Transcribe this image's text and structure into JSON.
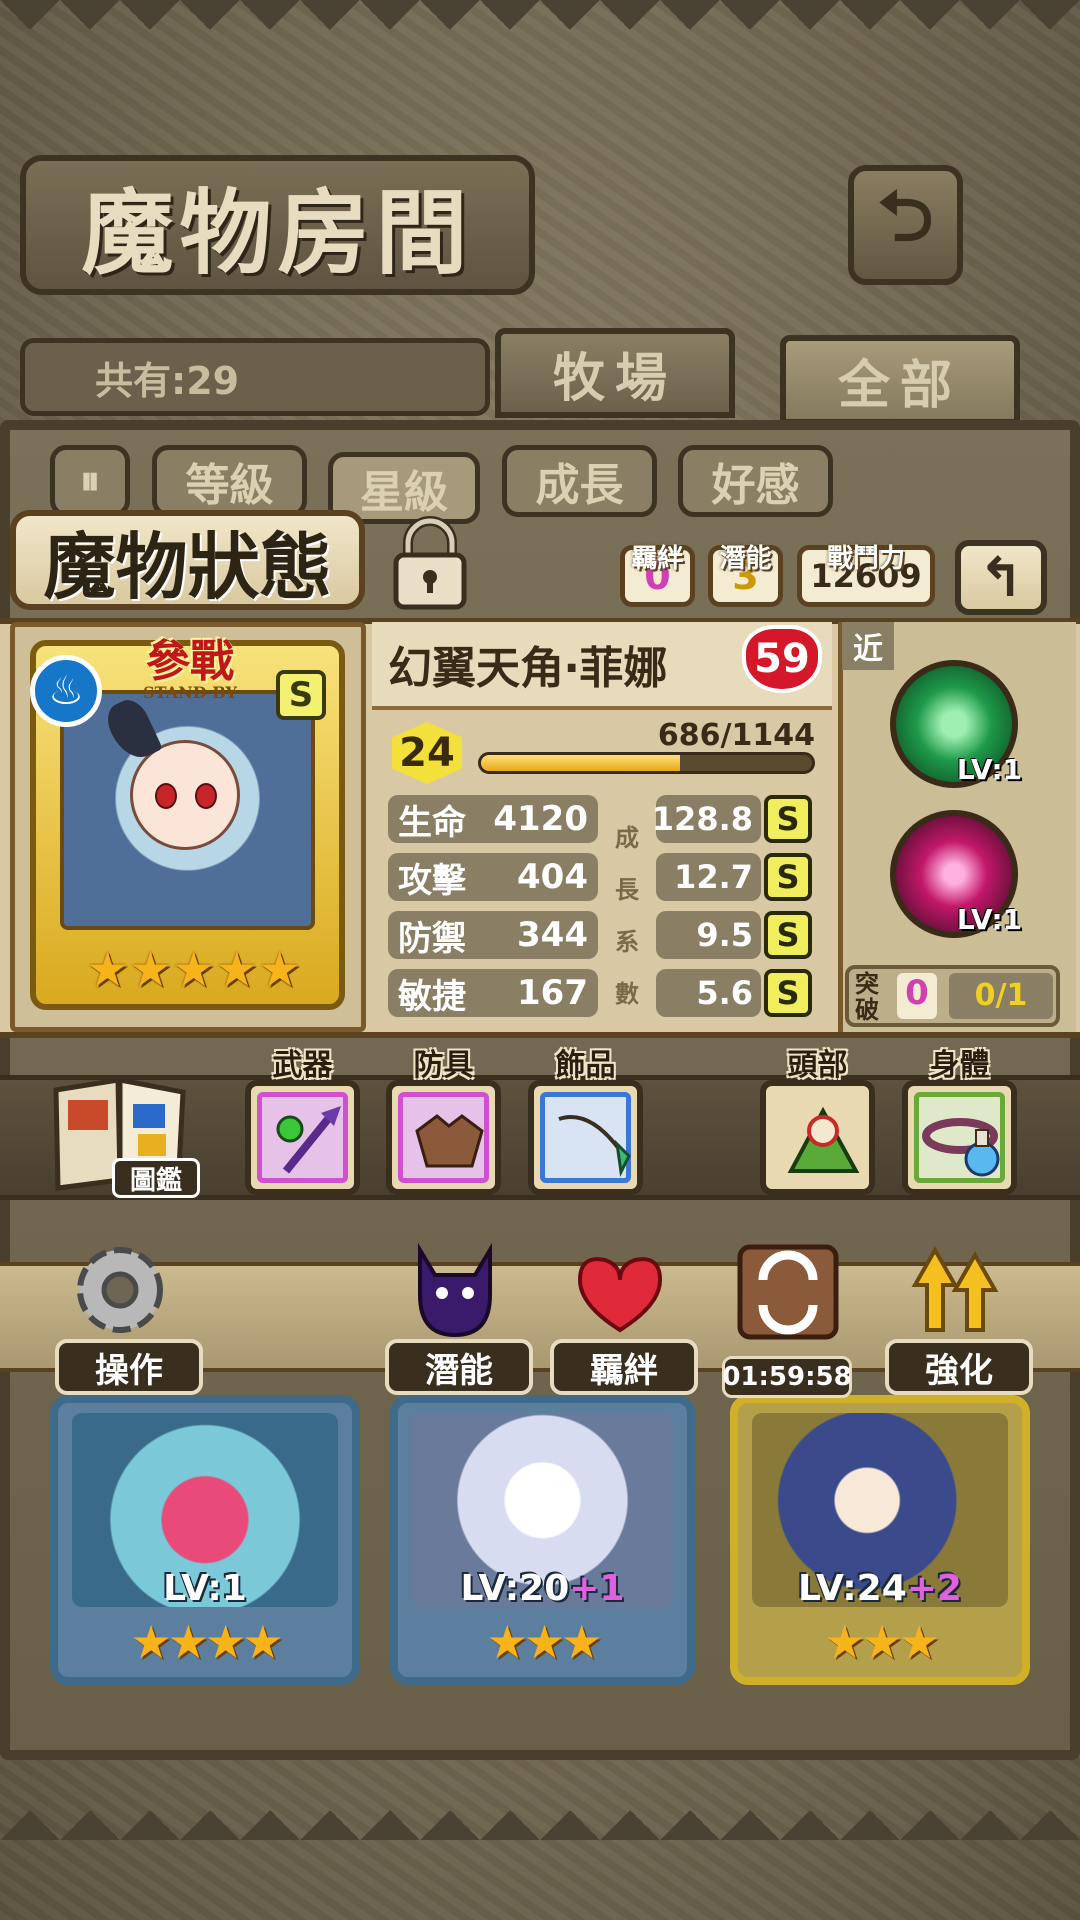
{
  "screen": {
    "title": "魔物房間",
    "total_count": "共有:29",
    "tabs": [
      {
        "label": "牧場"
      },
      {
        "label": "全部"
      }
    ],
    "filters": [
      {
        "label": "等級"
      },
      {
        "label": "星級"
      },
      {
        "label": "成長"
      },
      {
        "label": "好感"
      }
    ]
  },
  "status_panel": {
    "title": "魔物狀態",
    "chips": {
      "bond": {
        "label": "羈絆",
        "value": "0"
      },
      "potential": {
        "label": "潛能",
        "value": "3"
      },
      "power": {
        "label": "戰鬥力",
        "value": "12609"
      }
    },
    "standby": {
      "main": "參戰",
      "sub": "STAND BY"
    },
    "rank": "S",
    "star_count": 5,
    "name": "幻翼天角‧菲娜",
    "affection": "59",
    "level": "24",
    "exp_text": "686/1144",
    "exp_fraction": 0.6,
    "growth_label": [
      "成",
      "長",
      "系",
      "數"
    ],
    "stats": [
      {
        "label": "生命",
        "value": "4120",
        "growth": "128.8",
        "grade": "S"
      },
      {
        "label": "攻擊",
        "value": "404",
        "growth": "12.7",
        "grade": "S"
      },
      {
        "label": "防禦",
        "value": "344",
        "growth": "9.5",
        "grade": "S"
      },
      {
        "label": "敏捷",
        "value": "167",
        "growth": "5.6",
        "grade": "S"
      }
    ],
    "range": "近",
    "skills": [
      {
        "lv": "LV:1",
        "color": "#1e9a4a"
      },
      {
        "lv": "LV:1",
        "color": "#c2186a"
      }
    ],
    "breakthrough": {
      "label": "突破",
      "count": "0",
      "progress": "0/1"
    }
  },
  "equipment": {
    "book_label": "圖鑑",
    "slots": [
      {
        "label": "武器",
        "border": "#d050d0"
      },
      {
        "label": "防具",
        "border": "#d050d0"
      },
      {
        "label": "飾品",
        "border": "#3a78d8"
      },
      {
        "label": "頭部",
        "border": "#e8d9b2"
      },
      {
        "label": "身體",
        "border": "#6aa83a"
      }
    ]
  },
  "actions": [
    {
      "label": "操作"
    },
    {
      "label": "潛能"
    },
    {
      "label": "羈絆"
    },
    {
      "label": "01:59:58"
    },
    {
      "label": "強化"
    }
  ],
  "monster_cards": [
    {
      "lv": "LV:1",
      "plus": "",
      "stars": "★★★★"
    },
    {
      "lv": "LV:20",
      "plus": "+1",
      "stars": "★★★"
    },
    {
      "lv": "LV:24",
      "plus": "+2",
      "stars": "★★★"
    }
  ]
}
